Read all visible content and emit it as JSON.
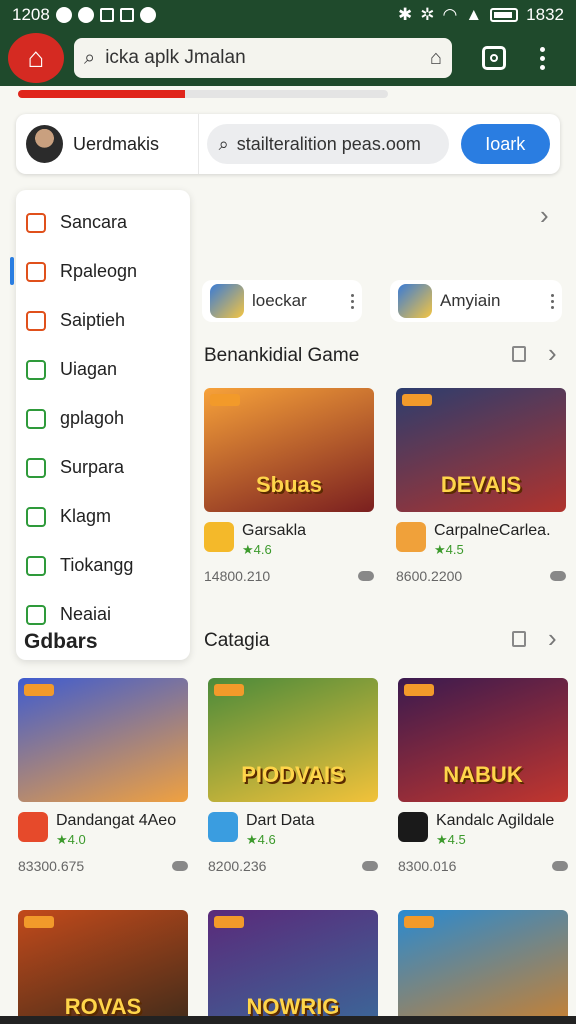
{
  "status_bar": {
    "time": "1208",
    "clock": "1832"
  },
  "browser": {
    "search_text": "icka aplk Jmalan"
  },
  "progress": {
    "fraction": 0.45
  },
  "profile": {
    "username": "Uerdmakis",
    "url": "stailteralition peas.oom",
    "load_label": "Ioark"
  },
  "side_menu": {
    "items": [
      {
        "label": "Sancara",
        "color": "#e0501b"
      },
      {
        "label": "Rpaleogn",
        "color": "#e0501b"
      },
      {
        "label": "Saiptieh",
        "color": "#e0501b"
      },
      {
        "label": "Uiagan",
        "color": "#2e9a3a"
      },
      {
        "label": "gplagoh",
        "color": "#2e9a3a"
      },
      {
        "label": "Surpara",
        "color": "#2e9a3a"
      },
      {
        "label": "Klagm",
        "color": "#2e9a3a"
      },
      {
        "label": "Tiokangg",
        "color": "#2e9a3a"
      },
      {
        "label": "Neaiai",
        "color": "#2e9a3a"
      }
    ],
    "footer": "Gdbars"
  },
  "apps_row": [
    {
      "name": "loeckar"
    },
    {
      "name": "Amyiain"
    }
  ],
  "sections": {
    "featured_title": "Benankidial Game",
    "category_title": "Catagia"
  },
  "featured_cards": [
    {
      "name": "Garsakla",
      "rating": "★4.6",
      "stats": "14800.210",
      "art": "Sbuas",
      "colors": [
        "#f7a23a",
        "#7a1f1f"
      ],
      "icon": "#f4b92a"
    },
    {
      "name": "CarpalneCarlea.",
      "rating": "★4.5",
      "stats": "8600.2200",
      "art": "DEVAIS",
      "colors": [
        "#2c3d6e",
        "#b0332d"
      ],
      "icon": "#f0a13a"
    }
  ],
  "category_cards": [
    {
      "name": "Dandangat 4Aeo",
      "rating": "★4.0",
      "stats": "83300.675",
      "art": "",
      "colors": [
        "#3f5ccf",
        "#f0a140"
      ],
      "icon": "#e64a2b"
    },
    {
      "name": "Dart Data",
      "rating": "★4.6",
      "stats": "8200.236",
      "art": "PIODVAIS",
      "colors": [
        "#4b8a3a",
        "#f2c23a"
      ],
      "icon": "#3a9de0"
    },
    {
      "name": "Kandalc Agildale",
      "rating": "★4.5",
      "stats": "8300.016",
      "art": "NABUK",
      "colors": [
        "#3a1a4f",
        "#c2362e"
      ],
      "icon": "#1a1a1a"
    }
  ],
  "bottom_cards": [
    {
      "art": "ROVAS",
      "colors": [
        "#c24a1b",
        "#3b2a1a"
      ]
    },
    {
      "art": "NOWRIG",
      "colors": [
        "#5a2a7a",
        "#3a6a9a"
      ]
    },
    {
      "art": "",
      "colors": [
        "#2a8ad0",
        "#d0802a"
      ]
    }
  ]
}
